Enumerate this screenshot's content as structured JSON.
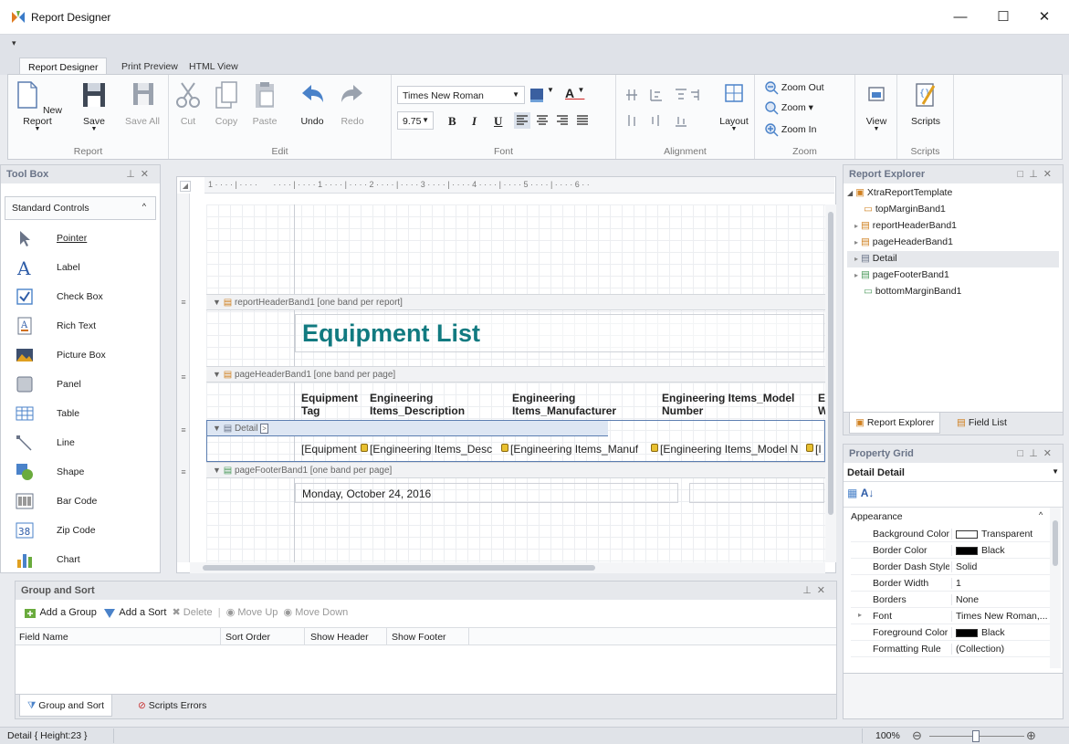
{
  "window": {
    "title": "Report Designer",
    "minimize": "—",
    "maximize": "☐",
    "close": "✕"
  },
  "ribbon_tabs": [
    {
      "label": "Report Designer",
      "active": true
    },
    {
      "label": "Print Preview",
      "active": false
    },
    {
      "label": "HTML View",
      "active": false
    }
  ],
  "ribbon": {
    "report": {
      "label": "Report",
      "new": "New Report",
      "save": "Save",
      "save_all": "Save All"
    },
    "edit": {
      "label": "Edit",
      "cut": "Cut",
      "copy": "Copy",
      "paste": "Paste",
      "undo": "Undo",
      "redo": "Redo"
    },
    "font": {
      "label": "Font",
      "family": "Times New Roman",
      "size": "9.75",
      "bold": "B",
      "italic": "I",
      "underline": "U"
    },
    "alignment": {
      "label": "Alignment",
      "layout": "Layout"
    },
    "zoom": {
      "label": "Zoom",
      "zoom_out": "Zoom Out",
      "zoom": "Zoom ▾",
      "zoom_in": "Zoom In"
    },
    "view": {
      "label": "View"
    },
    "scripts": {
      "label": "Scripts",
      "button": "Scripts"
    }
  },
  "toolbox": {
    "title": "Tool Box",
    "group": "Standard Controls",
    "items": [
      "Pointer",
      "Label",
      "Check Box",
      "Rich Text",
      "Picture Box",
      "Panel",
      "Table",
      "Line",
      "Shape",
      "Bar Code",
      "Zip Code",
      "Chart"
    ]
  },
  "designer": {
    "ruler": "1 · · · · | · · · ·       · · · · | · · · · 1 · · · · | · · · · 2 · · · · | · · · · 3 · · · · | · · · · 4 · · · · | · · · · 5 · · · · | · · · · 6 · ·",
    "bands": {
      "report_header": "reportHeaderBand1 [one band per report]",
      "page_header": "pageHeaderBand1 [one band per page]",
      "detail": "Detail",
      "page_footer": "pageFooterBand1 [one band per page]"
    },
    "title_text": "Equipment List",
    "headers": [
      {
        "line1": "Equipment",
        "line2": "Tag"
      },
      {
        "line1": "Engineering",
        "line2": "Items_Description"
      },
      {
        "line1": "Engineering",
        "line2": "Items_Manufacturer"
      },
      {
        "line1": "Engineering Items_Model",
        "line2": "Number"
      },
      {
        "line1": "E",
        "line2": "W"
      }
    ],
    "detail_cells": [
      "[Equipment",
      "[Engineering Items_Desc",
      "[Engineering Items_Manuf",
      "[Engineering Items_Model N",
      "[I"
    ],
    "footer_date": "Monday, October 24, 2016"
  },
  "group_sort": {
    "title": "Group and Sort",
    "toolbar": {
      "add_group": "Add a Group",
      "add_sort": "Add a Sort",
      "delete": "Delete",
      "move_up": "Move Up",
      "move_down": "Move Down"
    },
    "columns": [
      "Field Name",
      "Sort Order",
      "Show Header",
      "Show Footer"
    ],
    "tabs": [
      "Group and Sort",
      "Scripts Errors"
    ]
  },
  "explorer": {
    "title": "Report Explorer",
    "root": "XtraReportTemplate",
    "items": [
      "topMarginBand1",
      "reportHeaderBand1",
      "pageHeaderBand1",
      "Detail",
      "pageFooterBand1",
      "bottomMarginBand1"
    ],
    "tabs": [
      "Report Explorer",
      "Field List"
    ]
  },
  "property_grid": {
    "title": "Property Grid",
    "selected": "Detail  Detail",
    "category": "Appearance",
    "rows": [
      {
        "key": "Background Color",
        "value": "Transparent",
        "swatch": "#ffffff"
      },
      {
        "key": "Border Color",
        "value": "Black",
        "swatch": "#000000"
      },
      {
        "key": "Border Dash Style",
        "value": "Solid"
      },
      {
        "key": "Border Width",
        "value": "1"
      },
      {
        "key": "Borders",
        "value": "None"
      },
      {
        "key": "Font",
        "value": "Times New Roman,..."
      },
      {
        "key": "Foreground Color",
        "value": "Black",
        "swatch": "#000000"
      },
      {
        "key": "Formatting Rule",
        "value": "(Collection)"
      }
    ]
  },
  "status": {
    "left": "Detail { Height:23 }",
    "zoom": "100%"
  },
  "colors": {
    "accent": "#117a80",
    "band_selected": "#dde6f3",
    "panel_header": "#6a7488"
  }
}
